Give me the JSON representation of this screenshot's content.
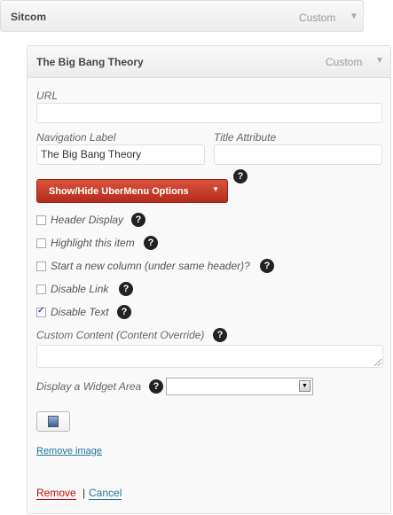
{
  "parent_item": {
    "title": "Sitcom",
    "type": "Custom",
    "arrow": "▼"
  },
  "menu_item": {
    "title": "The Big Bang Theory",
    "type": "Custom",
    "arrow": "▼",
    "url_label": "URL",
    "url_value": "",
    "nav_label_label": "Navigation Label",
    "nav_label_value": "The Big Bang Theory",
    "title_attr_label": "Title Attribute",
    "title_attr_value": "",
    "ubermenu_button": "Show/Hide UberMenu Options",
    "help_symbol": "?",
    "options": [
      {
        "label": "Header Display",
        "checked": false
      },
      {
        "label": "Highlight this item",
        "checked": false
      },
      {
        "label": "Start a new column (under same header)?",
        "checked": false
      },
      {
        "label": "Disable Link",
        "checked": false
      },
      {
        "label": "Disable Text",
        "checked": true
      }
    ],
    "custom_content_label": "Custom Content (Content Override)",
    "custom_content_value": "",
    "widget_area_label": "Display a Widget Area",
    "widget_area_selected": "",
    "image_icon": "picture-icon",
    "remove_image": "Remove image",
    "remove": "Remove",
    "separator": "|",
    "cancel": "Cancel"
  },
  "colors": {
    "button_red": "#c8402d",
    "link_blue": "#21759b",
    "remove_red": "#bc0b0b",
    "help_badge": "#222222"
  }
}
